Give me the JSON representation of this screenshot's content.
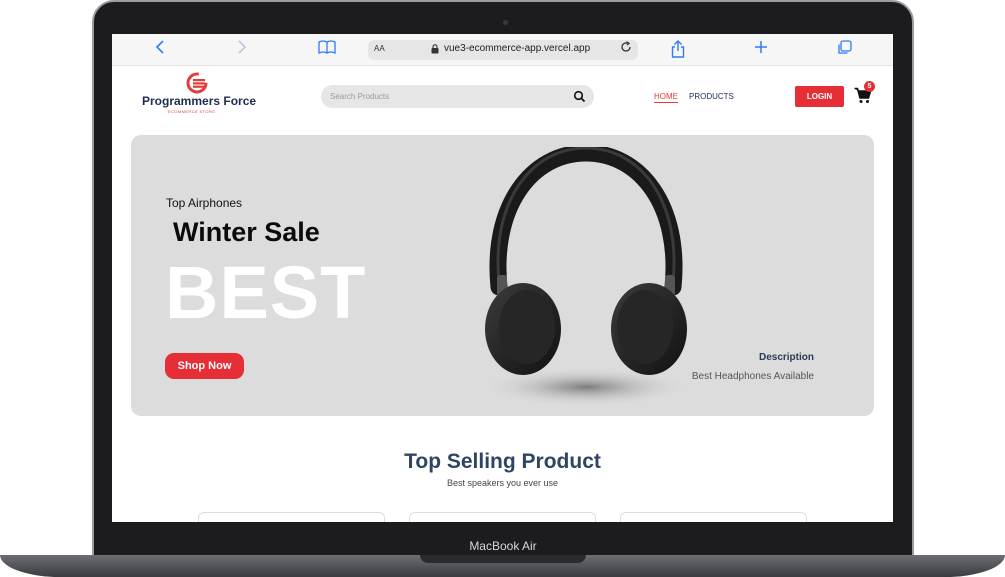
{
  "device": {
    "label": "MacBook Air"
  },
  "browser": {
    "text_size_label": "AA",
    "url": "vue3-ecommerce-app.vercel.app",
    "accent_color": "#2f7cf6"
  },
  "header": {
    "logo_title": "Programmers Force",
    "logo_subtitle": "ECOMMERCE STORE",
    "search_placeholder": "Search Products",
    "nav": {
      "home": "HOME",
      "products": "PRODUCTS"
    },
    "login_label": "LOGIN",
    "cart_count": "5",
    "brand_color": "#e62e36"
  },
  "hero": {
    "eyebrow": "Top Airphones",
    "title": "Winter Sale",
    "big_text": "BEST",
    "cta_label": "Shop Now",
    "description_title": "Description",
    "description_text": "Best Headphones Available"
  },
  "section": {
    "title": "Top Selling Product",
    "subtitle": "Best speakers you ever use"
  }
}
